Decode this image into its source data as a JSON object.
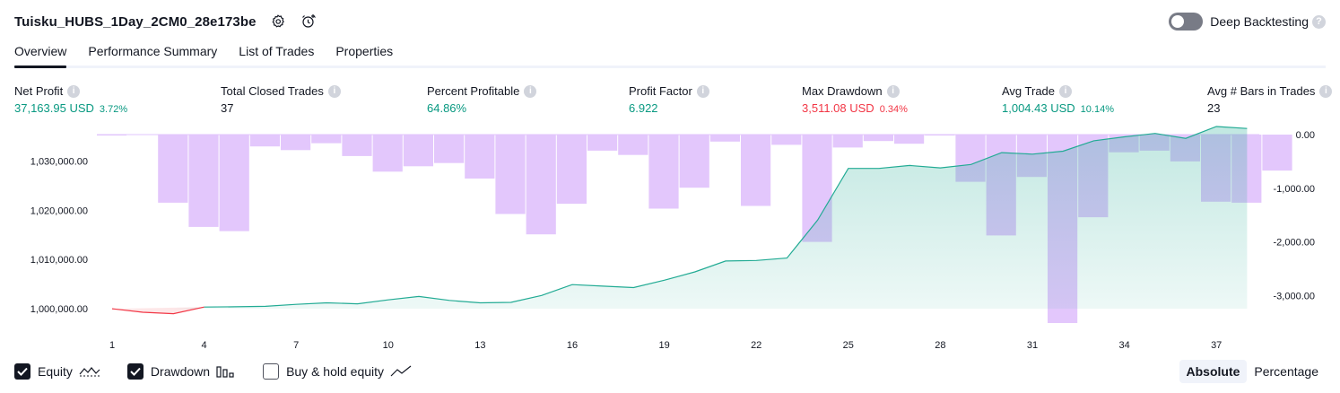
{
  "header": {
    "title": "Tuisku_HUBS_1Day_2CM0_28e173be",
    "settings_icon": "gear-icon",
    "alert_icon": "add-alert-icon"
  },
  "deep_backtesting": {
    "label": "Deep Backtesting",
    "enabled": false,
    "help": "?"
  },
  "tabs": [
    {
      "label": "Overview",
      "active": true
    },
    {
      "label": "Performance Summary",
      "active": false
    },
    {
      "label": "List of Trades",
      "active": false
    },
    {
      "label": "Properties",
      "active": false
    }
  ],
  "metrics": [
    {
      "label": "Net Profit",
      "value": "37,163.95 USD",
      "sub": "3.72%",
      "tone": "pos"
    },
    {
      "label": "Total Closed Trades",
      "value": "37",
      "sub": "",
      "tone": "plain"
    },
    {
      "label": "Percent Profitable",
      "value": "64.86%",
      "sub": "",
      "tone": "pos"
    },
    {
      "label": "Profit Factor",
      "value": "6.922",
      "sub": "",
      "tone": "pos"
    },
    {
      "label": "Max Drawdown",
      "value": "3,511.08 USD",
      "sub": "0.34%",
      "tone": "neg"
    },
    {
      "label": "Avg Trade",
      "value": "1,004.43 USD",
      "sub": "10.14%",
      "tone": "pos"
    },
    {
      "label": "Avg # Bars in Trades",
      "value": "23",
      "sub": "",
      "tone": "plain"
    }
  ],
  "colors": {
    "equity_line": "#22ab94",
    "equity_fill": "#22ab94",
    "equity_below_line": "#f23645",
    "drawdown_bar": "#e1c4fc",
    "positive": "#089981",
    "negative": "#f23645"
  },
  "chart_data": {
    "type": "area",
    "x_ticks": [
      "1",
      "4",
      "7",
      "10",
      "13",
      "16",
      "19",
      "22",
      "25",
      "28",
      "31",
      "34",
      "37"
    ],
    "left_axis": {
      "ticks": [
        "1,000,000.00",
        "1,010,000.00",
        "1,020,000.00",
        "1,030,000.00"
      ],
      "range": [
        998200,
        1035000
      ]
    },
    "right_axis": {
      "ticks": [
        "0.00",
        "-1,000.00",
        "-2,000.00",
        "-3,000.00"
      ],
      "range": [
        -3600,
        0
      ]
    },
    "series": [
      {
        "name": "Equity",
        "axis": "left",
        "x": [
          1,
          2,
          3,
          4,
          5,
          6,
          7,
          8,
          9,
          10,
          11,
          12,
          13,
          14,
          15,
          16,
          17,
          18,
          19,
          20,
          21,
          22,
          23,
          24,
          25,
          26,
          27,
          28,
          29,
          30,
          31,
          32,
          33,
          34,
          35,
          36,
          37,
          38
        ],
        "values": [
          1000000,
          999300,
          999000,
          1000350,
          1000400,
          1000500,
          1000900,
          1001200,
          1001000,
          1001800,
          1002500,
          1001700,
          1001200,
          1001300,
          1002700,
          1004900,
          1004600,
          1004300,
          1005800,
          1007500,
          1009700,
          1009800,
          1010300,
          1018000,
          1028500,
          1028500,
          1029100,
          1028600,
          1029300,
          1031700,
          1031400,
          1032000,
          1034100,
          1034900,
          1035600,
          1034600,
          1037000,
          1036600
        ]
      },
      {
        "name": "Drawdown",
        "axis": "right",
        "values": [
          -15,
          -1270,
          -1720,
          -1800,
          -220,
          -290,
          -160,
          -400,
          -690,
          -590,
          -530,
          -820,
          -1480,
          -1860,
          -1290,
          -300,
          -380,
          -1380,
          -990,
          -130,
          -1330,
          -190,
          -2000,
          -240,
          -120,
          -170,
          -10,
          -880,
          -1880,
          -790,
          -3511,
          -1540,
          -330,
          -300,
          -500,
          -1250,
          -1270,
          -670
        ]
      },
      {
        "name": "Buy & hold equity",
        "axis": "left",
        "values": []
      }
    ],
    "grid": false,
    "legend": "bottom-left"
  },
  "footer": {
    "equity_label": "Equity",
    "drawdown_label": "Drawdown",
    "buyhold_label": "Buy & hold equity",
    "equity_checked": true,
    "drawdown_checked": true,
    "buyhold_checked": false
  },
  "mode": {
    "absolute_label": "Absolute",
    "percentage_label": "Percentage",
    "selected": "Absolute"
  }
}
